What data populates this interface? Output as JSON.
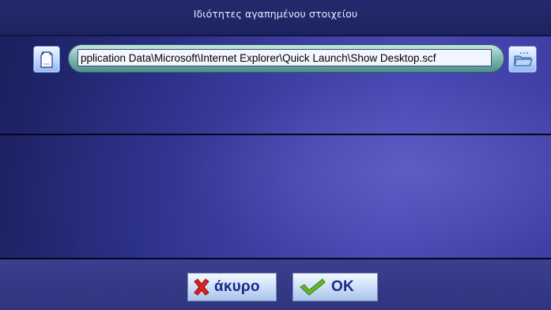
{
  "dialog": {
    "title": "Ιδιότητες αγαπημένου στοιχείου"
  },
  "path_field": {
    "value": "pplication Data\\Microsoft\\Internet Explorer\\Quick Launch\\Show Desktop.scf"
  },
  "icons": {
    "left_button_icon": "document-icon",
    "right_button_icon": "browse-folder-icon",
    "cancel_icon": "red-x-icon",
    "ok_icon": "green-check-icon"
  },
  "buttons": {
    "cancel_label": "άκυρο",
    "ok_label": "OK"
  },
  "colors": {
    "background": "#2a2f86",
    "title_bar": "#1d2260",
    "label_blue": "#1a2a8a",
    "cancel_red": "#e02020",
    "ok_green": "#6ab42a"
  }
}
